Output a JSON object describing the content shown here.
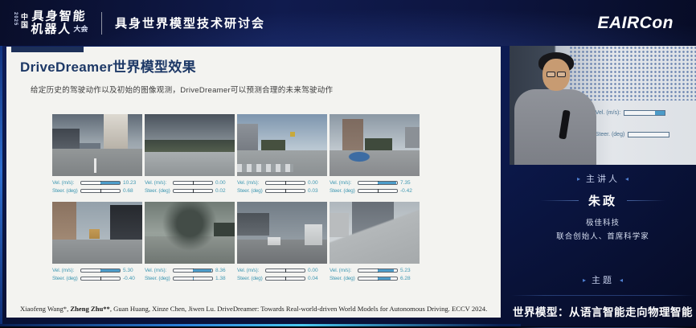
{
  "header": {
    "logo": {
      "year": "2025",
      "country": "中国",
      "line1": "具身智能",
      "line2": "机器人",
      "suffix": "大会"
    },
    "conference_title": "具身世界模型技术研讨会",
    "brand": "EAIRCon"
  },
  "slide": {
    "title": "DriveDreamer世界模型效果",
    "subtitle": "给定历史的驾驶动作以及初始的图像观测，DriveDreamer可以预测合理的未来驾驶动作",
    "vel_label": "Vel. (m/s):",
    "steer_label": "Steer. (deg)",
    "panels": [
      {
        "vel": "10.23",
        "steer": "0.68",
        "vel_fill": 100,
        "steer_fill": 0
      },
      {
        "vel": "0.00",
        "steer": "0.02",
        "vel_fill": 0,
        "steer_fill": 0
      },
      {
        "vel": "0.00",
        "steer": "0.03",
        "vel_fill": 0,
        "steer_fill": 0
      },
      {
        "vel": "7.35",
        "steer": "-0.42",
        "vel_fill": 95,
        "steer_fill": 0
      },
      {
        "vel": "5.30",
        "steer": "-0.40",
        "vel_fill": 100,
        "steer_fill": 0
      },
      {
        "vel": "8.36",
        "steer": "1.38",
        "vel_fill": 95,
        "steer_fill": 4
      },
      {
        "vel": "0.00",
        "steer": "0.04",
        "vel_fill": 0,
        "steer_fill": 0
      },
      {
        "vel": "5.23",
        "steer": "6.28",
        "vel_fill": 85,
        "steer_fill": 65
      }
    ],
    "citation": {
      "pre": "Xiaofeng Wang*, ",
      "bold": "Zheng Zhu**",
      "post": ", Guan Huang, Xinze Chen, Jiwen Lu. DriveDreamer: Towards Real-world-driven World Models for Autonomous Driving. ECCV 2024."
    }
  },
  "sidebar": {
    "speaker_label": "主讲人",
    "speaker_name": "朱政",
    "company": "极佳科技",
    "role": "联合创始人、首席科学家",
    "topic_label": "主题",
    "topic": "世界模型：从语言智能走向物理智能",
    "video_overlay": {
      "vel": "Vel. (m/s):",
      "steer": "Steer. (deg)"
    }
  },
  "colors": {
    "accent_fill_blue": "#4c9cc9",
    "gauge_text_teal": "#3f98b2",
    "slide_title_navy": "#1d3866",
    "background_navy": "#0d1c55",
    "bottom_accent_cyan": "#49c8ee"
  }
}
